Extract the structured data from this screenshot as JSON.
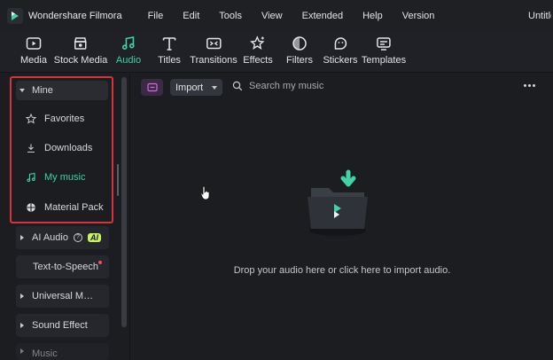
{
  "window": {
    "app_name": "Wondershare Filmora",
    "title_right": "Untitled"
  },
  "menu": [
    "File",
    "Edit",
    "Tools",
    "View",
    "Extended",
    "Help",
    "Version"
  ],
  "toolbar": [
    {
      "label": "Media",
      "icon": "media-icon"
    },
    {
      "label": "Stock Media",
      "icon": "stock-media-icon"
    },
    {
      "label": "Audio",
      "icon": "audio-icon",
      "active": true
    },
    {
      "label": "Titles",
      "icon": "titles-icon"
    },
    {
      "label": "Transitions",
      "icon": "transitions-icon"
    },
    {
      "label": "Effects",
      "icon": "effects-icon"
    },
    {
      "label": "Filters",
      "icon": "filters-icon"
    },
    {
      "label": "Stickers",
      "icon": "stickers-icon"
    },
    {
      "label": "Templates",
      "icon": "templates-icon"
    }
  ],
  "sidebar": {
    "mine": {
      "label": "Mine",
      "items": [
        {
          "label": "Favorites",
          "icon": "star-icon"
        },
        {
          "label": "Downloads",
          "icon": "download-icon"
        },
        {
          "label": "My music",
          "icon": "music-note-icon",
          "active": true
        },
        {
          "label": "Material Pack",
          "icon": "pack-icon"
        }
      ]
    },
    "ai_audio": {
      "label": "AI Audio",
      "badge": "AI"
    },
    "tts": {
      "label": "Text-to-Speech"
    },
    "universal": {
      "label": "Universal Music"
    },
    "sound_effect": {
      "label": "Sound Effect"
    },
    "music": {
      "label": "Music"
    }
  },
  "main": {
    "import_label": "Import",
    "search_placeholder": "Search my music",
    "drop_text": "Drop your audio here or click here to import audio."
  },
  "colors": {
    "accent": "#3fd3a6",
    "highlight_border": "#d6333a",
    "background": "#1b1d21"
  }
}
